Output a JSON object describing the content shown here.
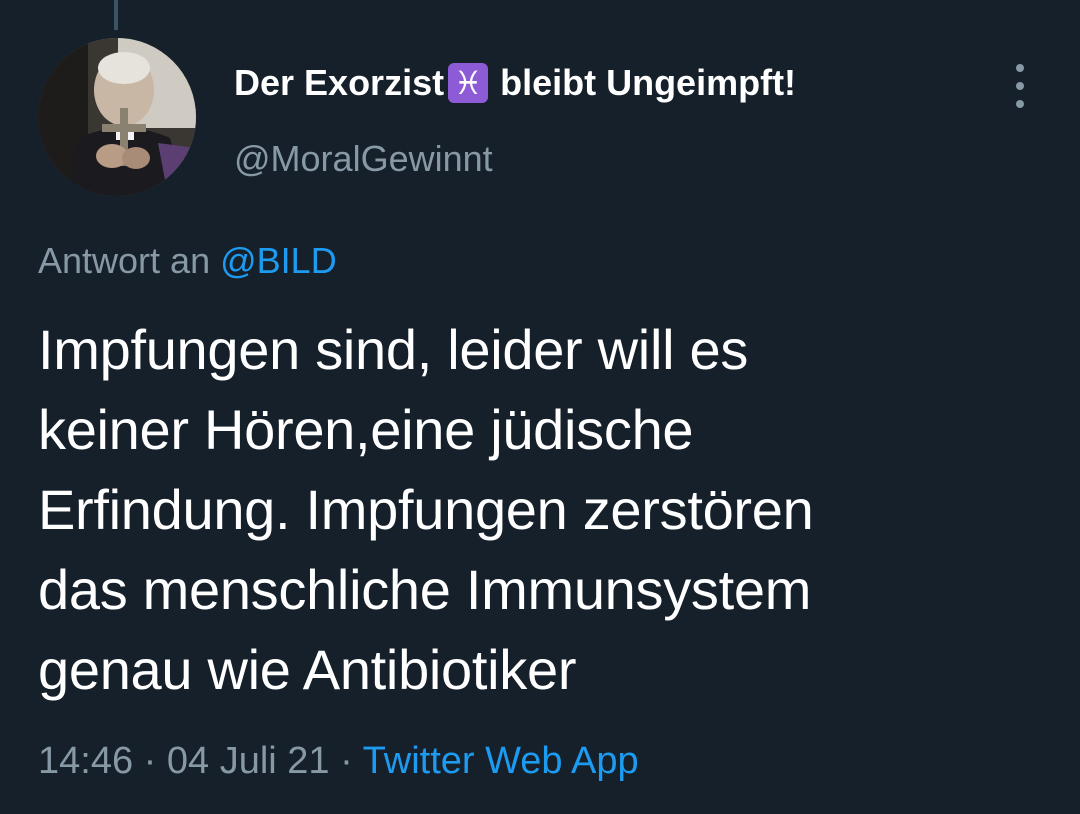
{
  "tweet": {
    "display_name_before": "Der Exorzist",
    "display_name_emoji": "♓",
    "display_name_after": "bleibt Ungeimpft!",
    "handle": "@MoralGewinnt",
    "reply_label": "Antwort an",
    "reply_mention": "@BILD",
    "text_lines": [
      "Impfungen sind, leider will es",
      "keiner Hören,eine jüdische",
      "Erfindung. Impfungen zerstören",
      "das menschliche Immunsystem",
      "genau wie Antibiotiker"
    ],
    "time": "14:46",
    "separator": "·",
    "date": "04 Juli 21",
    "source": "Twitter Web App"
  },
  "icons": {
    "more": "more-vertical-icon",
    "avatar": "user-avatar-image"
  },
  "colors": {
    "background": "#15202b",
    "text_primary": "#ffffff",
    "text_secondary": "#8899a6",
    "link": "#1d9bf0",
    "zodiac_badge": "#8e5bd6"
  }
}
